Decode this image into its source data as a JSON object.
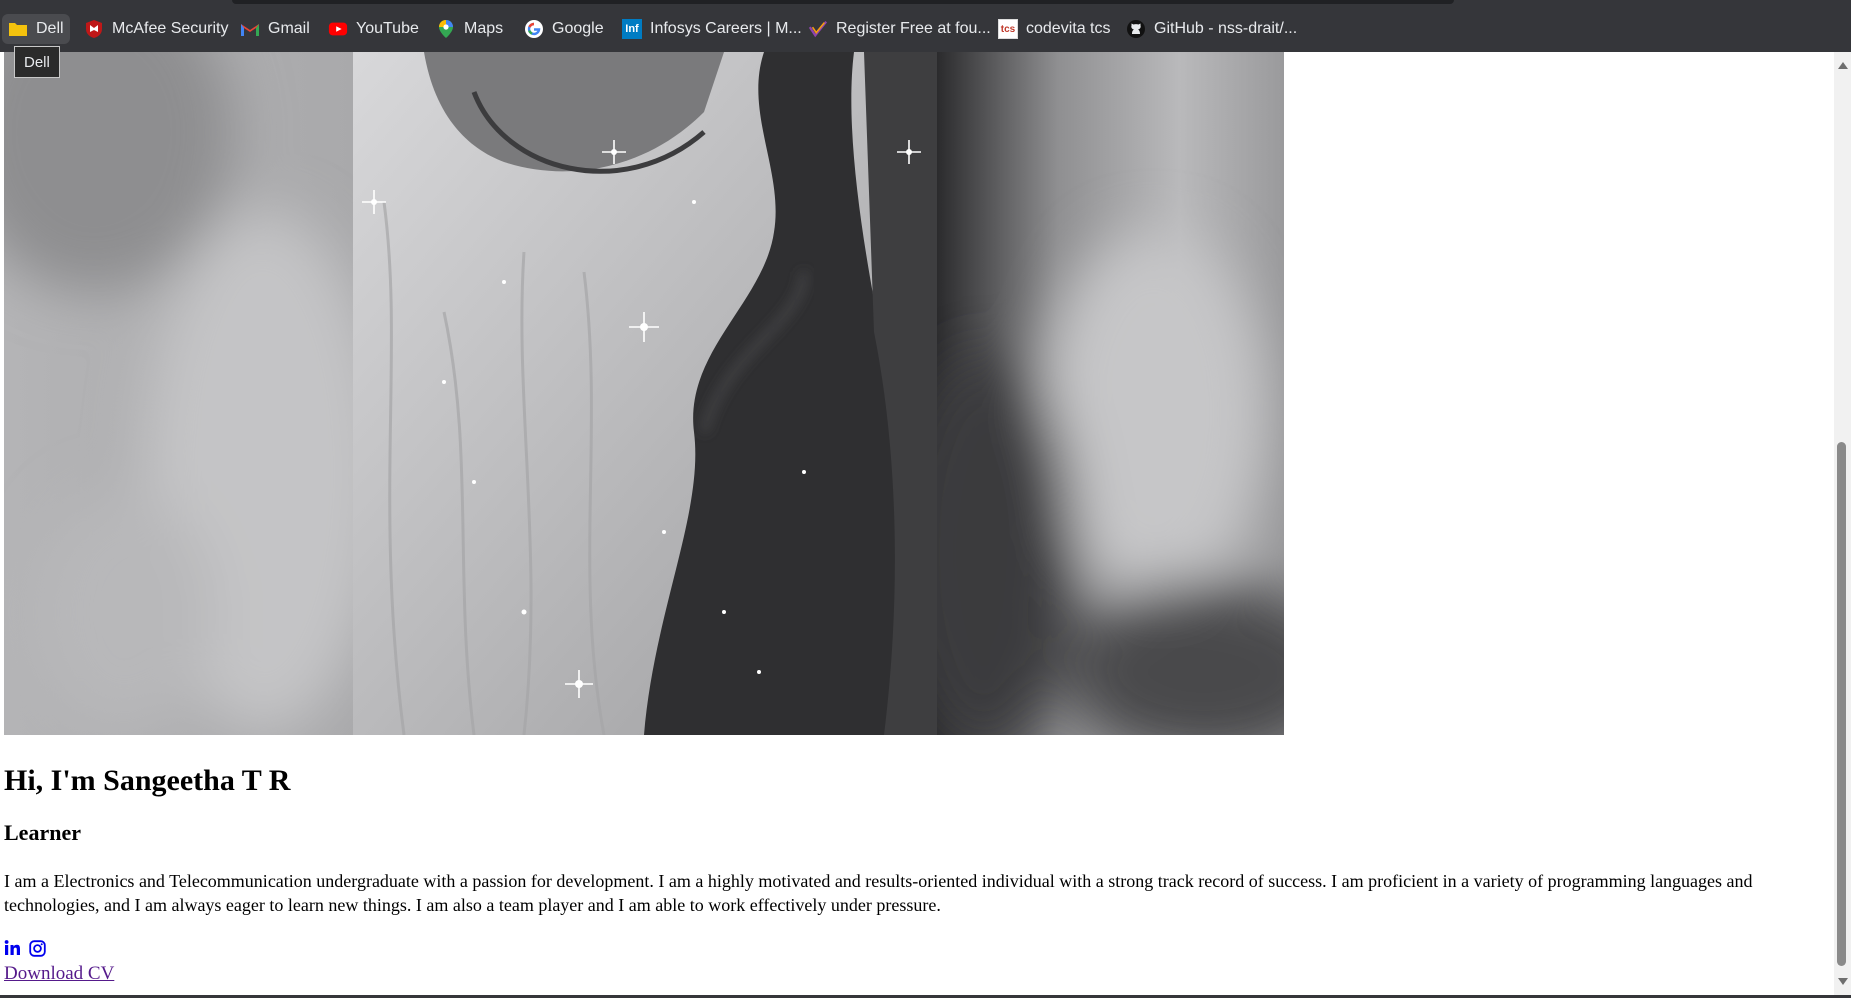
{
  "bookmarks": [
    {
      "label": "Dell",
      "icon": "folder-icon",
      "color": "#f4c20d"
    },
    {
      "label": "McAfee Security",
      "icon": "mcafee-icon",
      "color": "#c01818"
    },
    {
      "label": "Gmail",
      "icon": "gmail-icon",
      "color": "#ea4335"
    },
    {
      "label": "YouTube",
      "icon": "youtube-icon",
      "color": "#ff0000"
    },
    {
      "label": "Maps",
      "icon": "maps-pin-icon",
      "color": "#34a853"
    },
    {
      "label": "Google",
      "icon": "google-icon",
      "color": "#4285f4"
    },
    {
      "label": "Infosys Careers | M...",
      "icon": "infosys-icon",
      "icon_text": "Inf",
      "color": "#007cc3"
    },
    {
      "label": "Register Free at fou...",
      "icon": "checkmark-logo-icon",
      "color": "#8e44ad"
    },
    {
      "label": "codevita tcs",
      "icon": "tcs-icon",
      "icon_text": "tcs",
      "color": "#c0392b"
    },
    {
      "label": "GitHub - nss-drait/...",
      "icon": "github-icon",
      "color": "#111111"
    }
  ],
  "tooltip": {
    "text": "Dell"
  },
  "profile": {
    "name_heading": "Hi, I'm Sangeetha T R",
    "role": "Learner",
    "bio": "I am a Electronics and Telecommunication undergraduate with a passion for development. I am a highly motivated and results-oriented individual with a strong track record of success. I am proficient in a variety of programming languages and technologies, and I am always eager to learn new things. I am also a team player and I am able to work effectively under pressure.",
    "download_cv": "Download CV"
  },
  "social_links": [
    {
      "icon": "linkedin-icon",
      "color": "#0000ee"
    },
    {
      "icon": "instagram-icon",
      "color": "#0000ee"
    }
  ],
  "colors": {
    "bookmark_bar_bg": "#35363a",
    "page_bg": "#ffffff",
    "visited_link": "#551a8b",
    "social_icon": "#0000ee"
  }
}
